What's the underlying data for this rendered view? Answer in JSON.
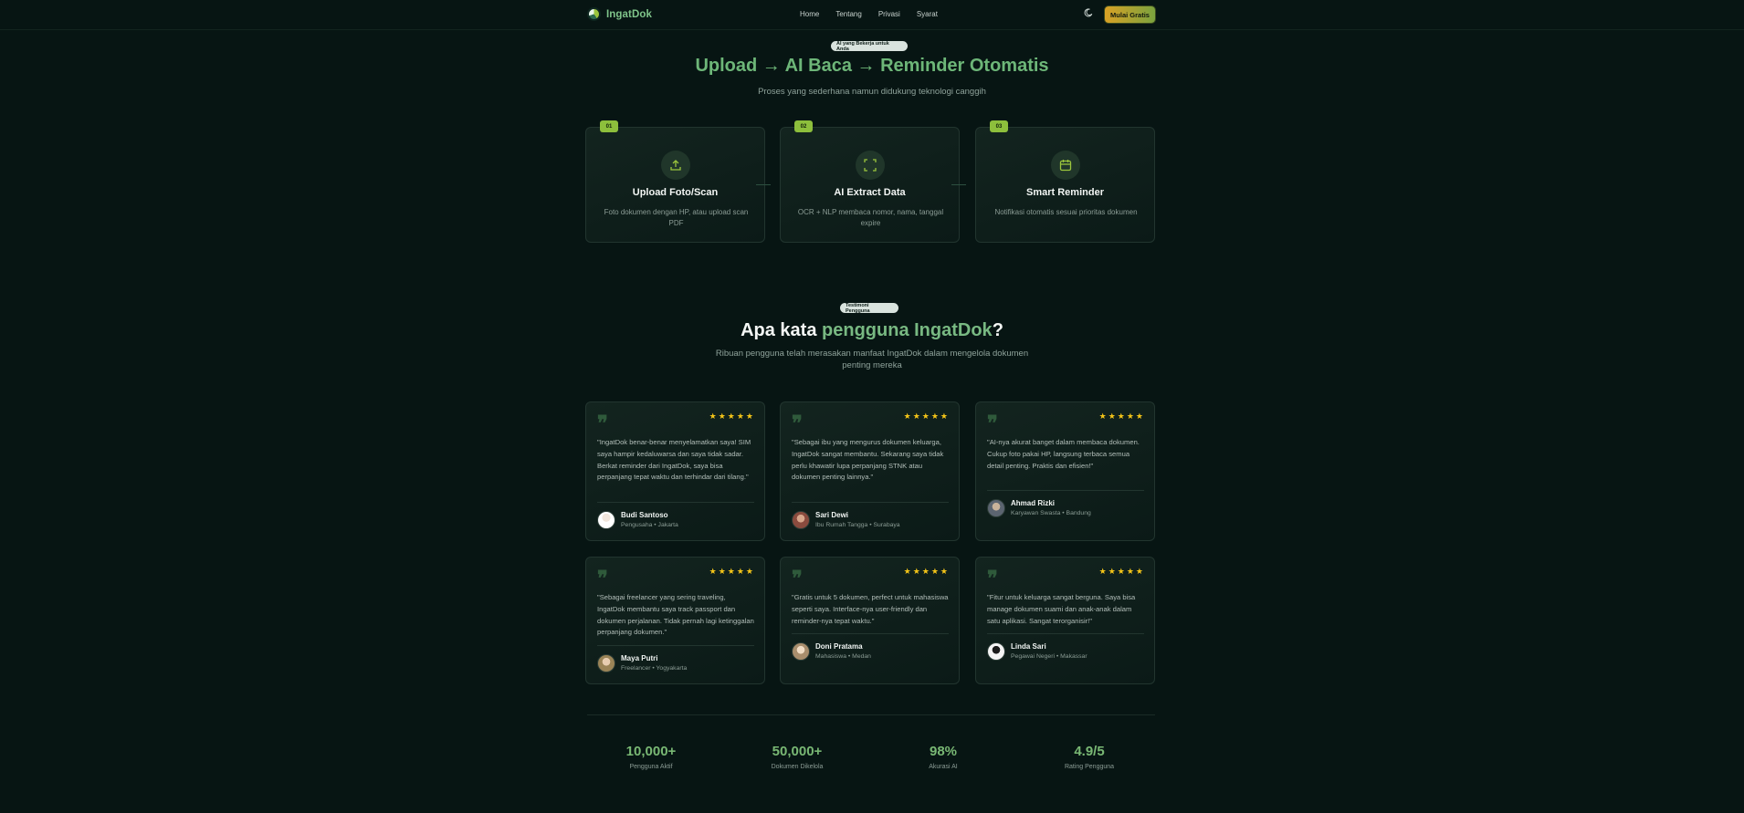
{
  "nav": {
    "brand": "IngatDok",
    "links": [
      "Home",
      "Tentang",
      "Privasi",
      "Syarat"
    ],
    "cta": "Mulai Gratis"
  },
  "how": {
    "badge": "AI yang Bekerja untuk Anda",
    "title": "Upload → AI Baca → Reminder Otomatis",
    "subtitle": "Proses yang sederhana namun didukung teknologi canggih",
    "steps": [
      {
        "num": "01",
        "icon": "upload-icon",
        "title": "Upload Foto/Scan",
        "desc": "Foto dokumen dengan HP, atau upload scan PDF"
      },
      {
        "num": "02",
        "icon": "scan-icon",
        "title": "AI Extract Data",
        "desc": "OCR + NLP membaca nomor, nama, tanggal expire"
      },
      {
        "num": "03",
        "icon": "calendar-icon",
        "title": "Smart Reminder",
        "desc": "Notifikasi otomatis sesuai prioritas dokumen"
      }
    ]
  },
  "testimonials": {
    "badge": "Testimoni Pengguna",
    "title_pre": "Apa kata ",
    "title_hl": "pengguna IngatDok",
    "title_post": "?",
    "subtitle_line1": "Ribuan pengguna telah merasakan manfaat IngatDok dalam mengelola dokumen",
    "subtitle_line2": "penting mereka",
    "rating": 5,
    "items": [
      {
        "text": "\"IngatDok benar-benar menyelamatkan saya! SIM saya hampir kedaluwarsa dan saya tidak sadar. Berkat reminder dari IngatDok, saya bisa perpanjang tepat waktu dan terhindar dari tilang.\"",
        "name": "Budi Santoso",
        "role": "Pengusaha • Jakarta"
      },
      {
        "text": "\"Sebagai ibu yang mengurus dokumen keluarga, IngatDok sangat membantu. Sekarang saya tidak perlu khawatir lupa perpanjang STNK atau dokumen penting lainnya.\"",
        "name": "Sari Dewi",
        "role": "Ibu Rumah Tangga • Surabaya"
      },
      {
        "text": "\"AI-nya akurat banget dalam membaca dokumen. Cukup foto pakai HP, langsung terbaca semua detail penting. Praktis dan efisien!\"",
        "name": "Ahmad Rizki",
        "role": "Karyawan Swasta • Bandung"
      },
      {
        "text": "\"Sebagai freelancer yang sering traveling, IngatDok membantu saya track passport dan dokumen perjalanan. Tidak pernah lagi ketinggalan perpanjang dokumen.\"",
        "name": "Maya Putri",
        "role": "Freelancer • Yogyakarta"
      },
      {
        "text": "\"Gratis untuk 5 dokumen, perfect untuk mahasiswa seperti saya. Interface-nya user-friendly dan reminder-nya tepat waktu.\"",
        "name": "Doni Pratama",
        "role": "Mahasiswa • Medan"
      },
      {
        "text": "\"Fitur untuk keluarga sangat berguna. Saya bisa manage dokumen suami dan anak-anak dalam satu aplikasi. Sangat terorganisir!\"",
        "name": "Linda Sari",
        "role": "Pegawai Negeri • Makassar"
      }
    ]
  },
  "stats": [
    {
      "value": "10,000+",
      "label": "Pengguna Aktif"
    },
    {
      "value": "50,000+",
      "label": "Dokumen Dikelola"
    },
    {
      "value": "98%",
      "label": "Akurasi AI"
    },
    {
      "value": "4.9/5",
      "label": "Rating Pengguna"
    }
  ],
  "colors": {
    "accent": "#8dbf3c",
    "star": "#f5c518",
    "background": "#071513"
  }
}
